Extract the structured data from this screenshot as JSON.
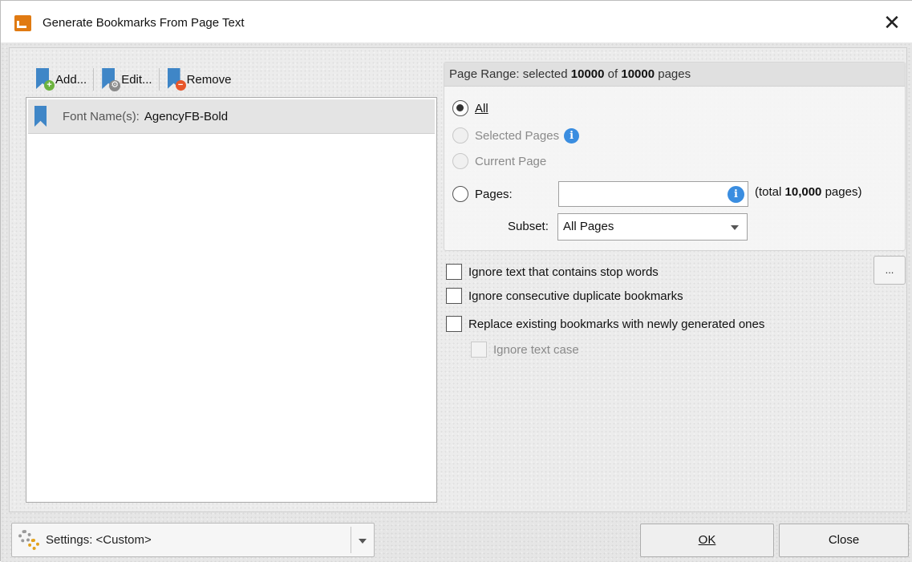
{
  "window": {
    "title": "Generate Bookmarks From Page Text",
    "close_glyph": "✕"
  },
  "toolbar": {
    "add_label": "Add...",
    "edit_label": "Edit...",
    "remove_label": "Remove"
  },
  "list": {
    "items": [
      {
        "label": "Font Name(s):",
        "value": "AgencyFB-Bold"
      }
    ]
  },
  "page_range": {
    "header_prefix": "Page Range: selected ",
    "selected_count": "10000",
    "header_mid": " of ",
    "total_count": "10000",
    "header_suffix": " pages",
    "options": {
      "all": {
        "label": "All",
        "checked": true
      },
      "selected_pages": {
        "label": "Selected Pages",
        "disabled": true
      },
      "current_page": {
        "label": "Current Page",
        "disabled": true
      },
      "pages": {
        "label": "Pages:",
        "value": ""
      }
    },
    "total_prefix": "(total ",
    "total_value": "10,000",
    "total_suffix": " pages)",
    "subset_label": "Subset:",
    "subset_value": "All Pages"
  },
  "options": {
    "ignore_stop_words": {
      "label": "Ignore text that contains stop words",
      "checked": false
    },
    "ignore_duplicates": {
      "label": "Ignore consecutive duplicate bookmarks",
      "checked": false
    },
    "replace_existing": {
      "label": "Replace existing bookmarks with newly generated ones",
      "checked": false
    },
    "ignore_case": {
      "label": "Ignore text case",
      "checked": false,
      "disabled": true
    },
    "dots_label": "..."
  },
  "footer": {
    "settings_label": "Settings: <Custom>",
    "ok_label": "OK",
    "close_label": "Close"
  },
  "colors": {
    "accent": "#3f86c7",
    "info": "#3a8de0",
    "app_icon": "#e07a12"
  }
}
